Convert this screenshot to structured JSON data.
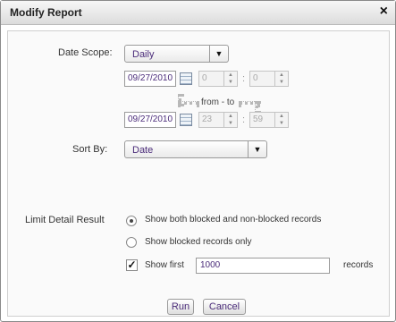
{
  "dialog": {
    "title": "Modify Report",
    "close_symbol": "×"
  },
  "date_scope": {
    "label": "Date Scope:",
    "selected": "Daily",
    "from": {
      "date": "09/27/2010",
      "hour": "0",
      "minute": "0"
    },
    "to": {
      "date": "09/27/2010",
      "hour": "23",
      "minute": "59"
    },
    "from_to_label": "from - to"
  },
  "sort_by": {
    "label": "Sort By:",
    "selected": "Date"
  },
  "limit_detail": {
    "label": "Limit Detail Result",
    "options": [
      {
        "label": "Show both blocked and non-blocked records",
        "checked": true
      },
      {
        "label": "Show blocked records only",
        "checked": false
      }
    ],
    "show_first": {
      "label": "Show first",
      "checked": true,
      "value": "1000",
      "suffix": "records"
    }
  },
  "buttons": {
    "run": "Run",
    "cancel": "Cancel"
  }
}
